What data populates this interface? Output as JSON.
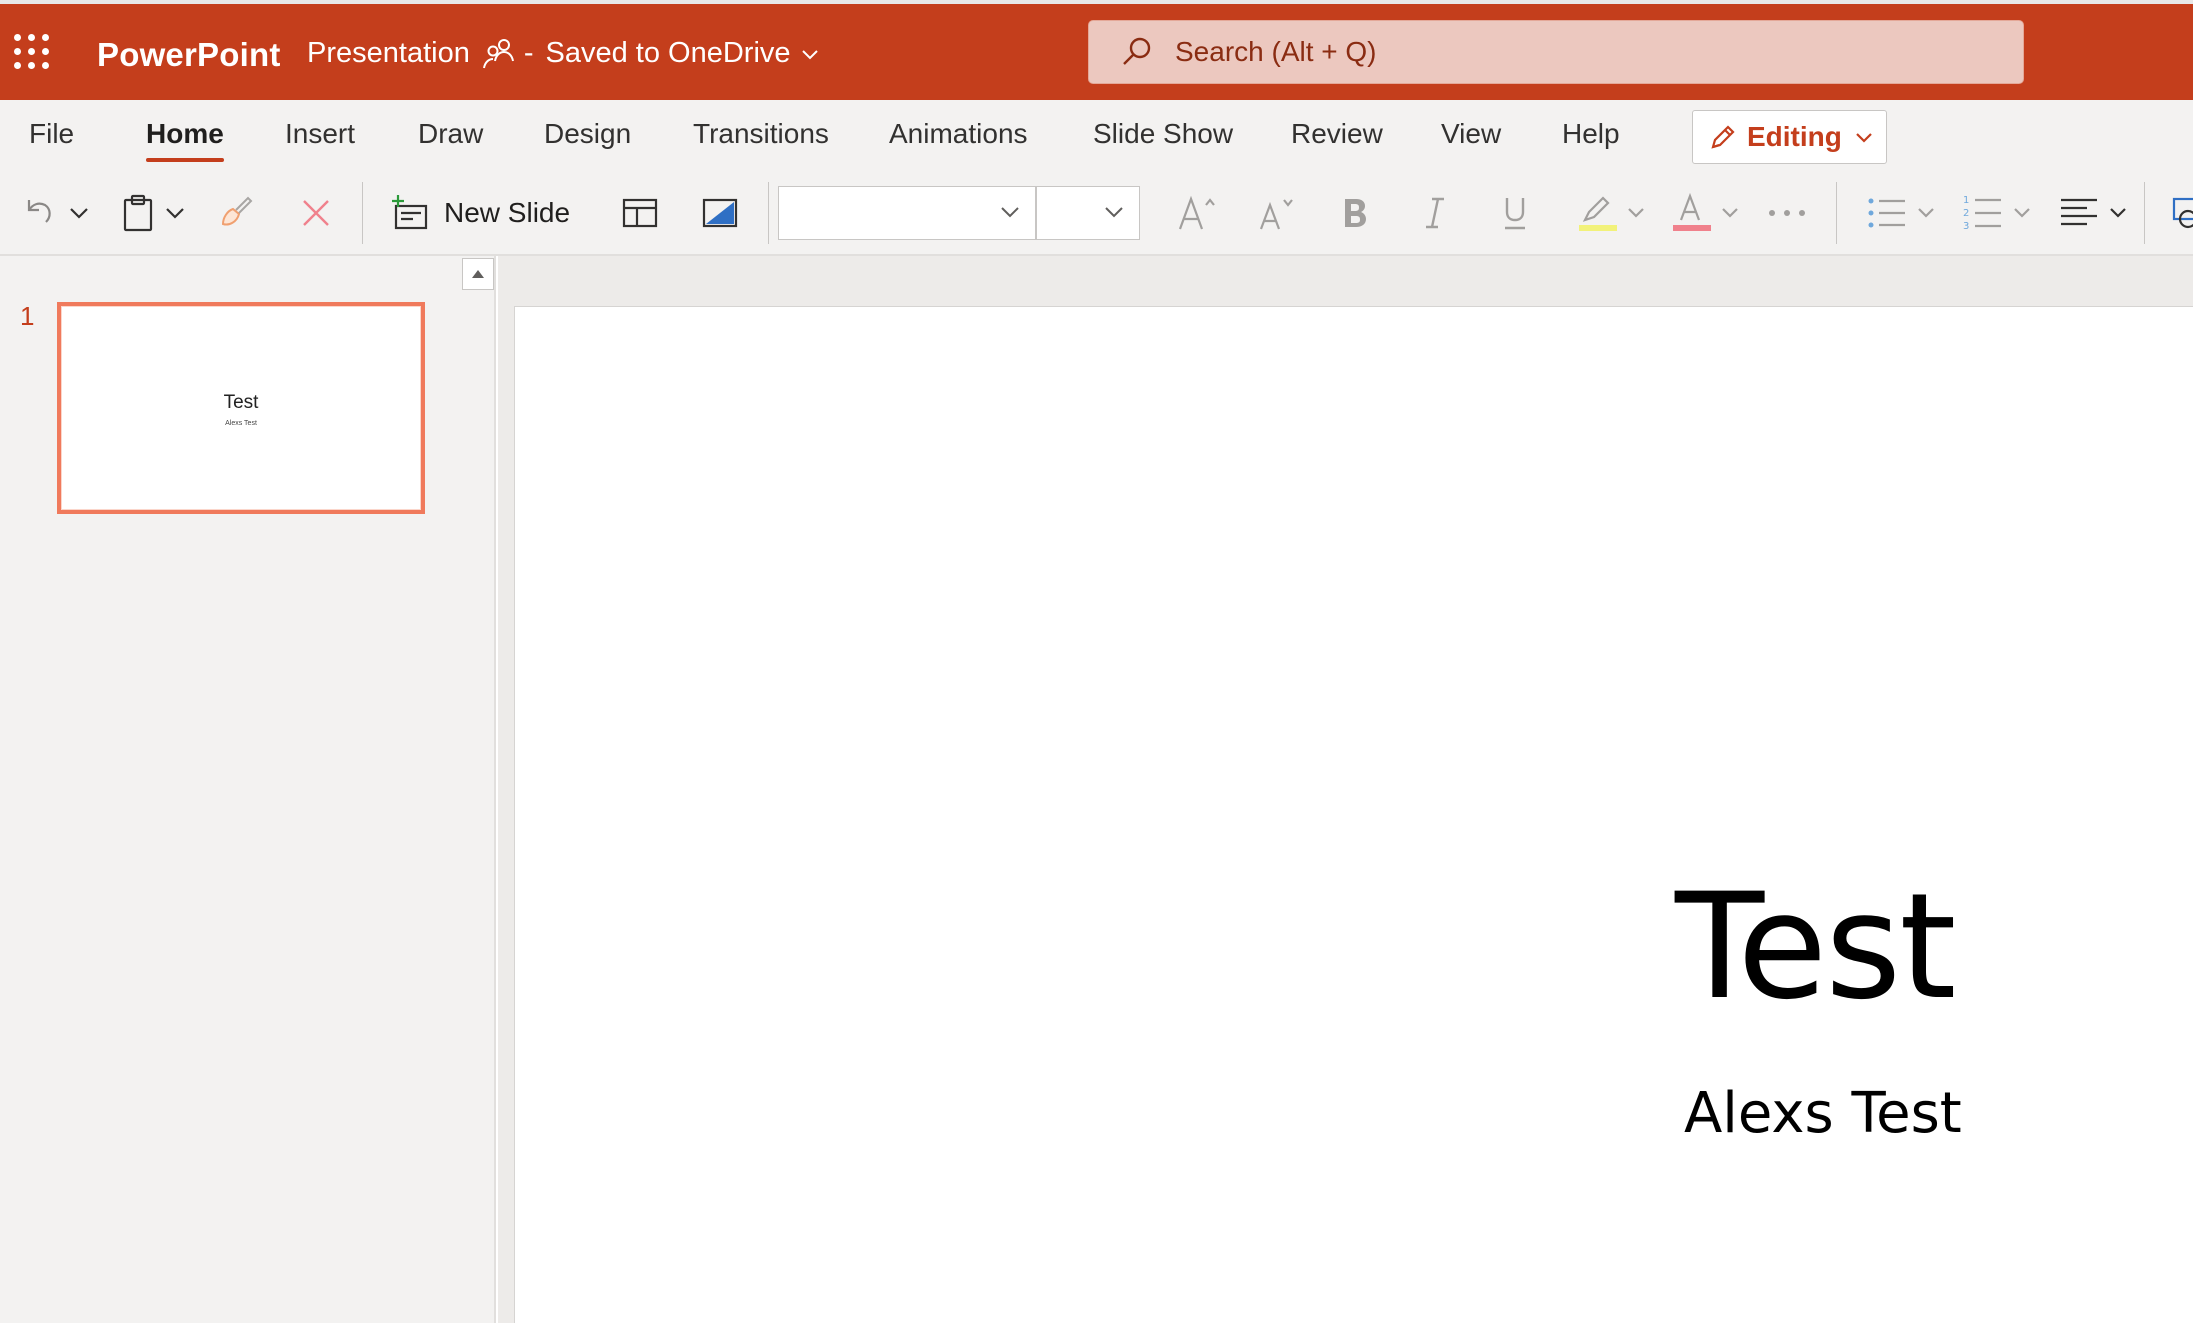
{
  "app": {
    "name": "PowerPoint",
    "document_title": "Presentation",
    "separator": "-",
    "save_status": "Saved to OneDrive"
  },
  "search": {
    "placeholder": "Search (Alt + Q)"
  },
  "ribbon": {
    "tabs": [
      "File",
      "Home",
      "Insert",
      "Draw",
      "Design",
      "Transitions",
      "Animations",
      "Slide Show",
      "Review",
      "View",
      "Help"
    ],
    "active_tab": "Home",
    "mode_button": "Editing"
  },
  "toolbar": {
    "new_slide_label": "New Slide",
    "font_name": "",
    "font_size": ""
  },
  "slides_panel": {
    "slides": [
      {
        "number": "1",
        "title": "Test",
        "subtitle": "Alexs Test",
        "selected": true
      }
    ]
  },
  "current_slide": {
    "title": "Test",
    "subtitle": "Alexs Test"
  },
  "colors": {
    "brand": "#c43e1c",
    "search_bg": "#ecc8bf",
    "thumb_border": "#f07a5c",
    "highlight": "#f2f27a",
    "font_color": "#f0818c"
  }
}
